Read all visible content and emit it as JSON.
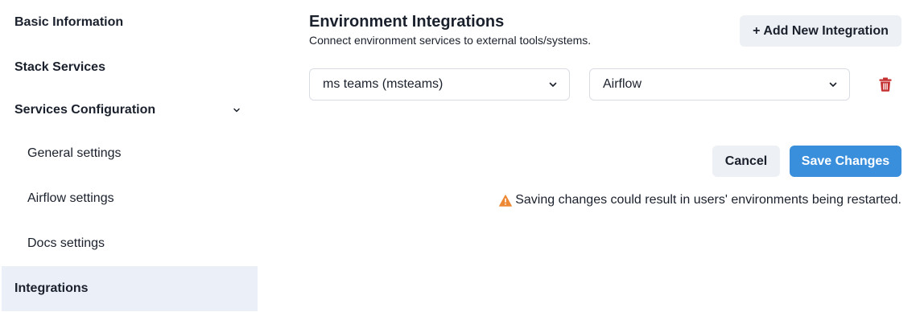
{
  "sidebar": {
    "items": [
      {
        "label": "Basic Information"
      },
      {
        "label": "Stack Services"
      },
      {
        "label": "Services Configuration"
      },
      {
        "label": "General settings"
      },
      {
        "label": "Airflow settings"
      },
      {
        "label": "Docs settings"
      },
      {
        "label": "Integrations"
      }
    ]
  },
  "main": {
    "title": "Environment Integrations",
    "subtitle": "Connect environment services to external tools/systems.",
    "add_button_label": "+ Add New Integration",
    "integration_row": {
      "integration_value": "ms teams (msteams)",
      "service_value": "Airflow"
    },
    "cancel_label": "Cancel",
    "save_label": "Save Changes",
    "warning_text": "Saving changes could result in users' environments being restarted."
  },
  "colors": {
    "primary": "#3a8fdd",
    "secondary_button": "#edf0f4",
    "active_nav": "#ebf0f8",
    "danger": "#c53030",
    "warning": "#ed8936"
  },
  "icons": {
    "chevron": "chevron-down-icon",
    "trash": "trash-icon",
    "warning": "warning-icon"
  }
}
